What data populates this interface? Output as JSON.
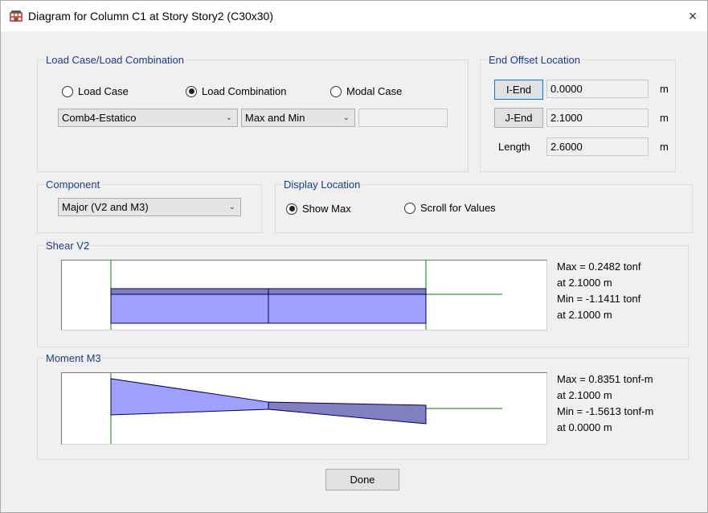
{
  "window": {
    "title": "Diagram for Column C1 at Story Story2 (C30x30)",
    "close_glyph": "×"
  },
  "load": {
    "legend": "Load Case/Load Combination",
    "options": [
      {
        "label": "Load Case",
        "selected": false
      },
      {
        "label": "Load Combination",
        "selected": true
      },
      {
        "label": "Modal Case",
        "selected": false
      }
    ],
    "combo_value": "Comb4-Estatico",
    "type_value": "Max and Min",
    "extra_value": ""
  },
  "offset": {
    "legend": "End Offset Location",
    "i_label": "I-End",
    "i_value": "0.0000",
    "j_label": "J-End",
    "j_value": "2.1000",
    "length_label": "Length",
    "length_value": "2.6000",
    "unit": "m"
  },
  "component": {
    "legend": "Component",
    "value": "Major (V2 and M3)"
  },
  "display": {
    "legend": "Display Location",
    "options": [
      {
        "label": "Show Max",
        "selected": true
      },
      {
        "label": "Scroll for Values",
        "selected": false
      }
    ]
  },
  "shear": {
    "legend": "Shear V2",
    "max_line": "Max = 0.2482 tonf",
    "max_at": "at 2.1000 m",
    "min_line": "Min = -1.1411 tonf",
    "min_at": "at 2.1000 m"
  },
  "moment": {
    "legend": "Moment M3",
    "max_line": "Max = 0.8351 tonf-m",
    "max_at": "at 2.1000 m",
    "min_line": "Min = -1.5613 tonf-m",
    "min_at": "at 0.0000 m"
  },
  "done_label": "Done",
  "colors": {
    "diagram_fill": "#a0a0ff",
    "diagram_fill_dark": "#8080c0",
    "axis_line": "#008000",
    "legend_text": "#1a3a8a"
  },
  "icons": {
    "app": "building-icon",
    "close": "close-icon",
    "dropdown": "chevron-down-icon"
  }
}
